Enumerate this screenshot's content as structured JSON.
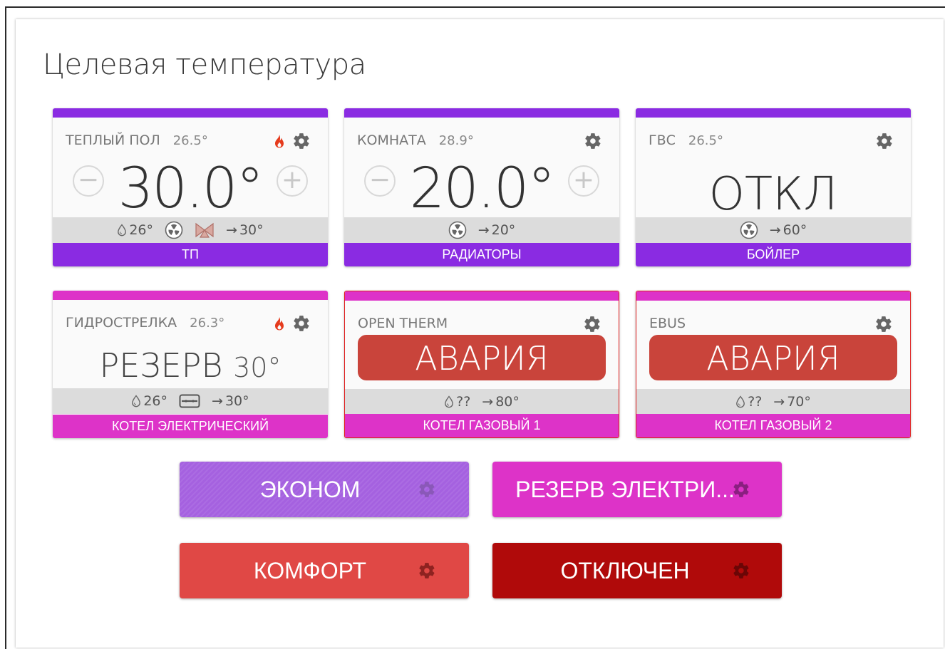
{
  "page": {
    "title": "Целевая температура"
  },
  "colors": {
    "purple": "#8a2be2",
    "magenta": "#dd33c8",
    "alarm_red": "#c9443b",
    "econom": "#a561e0",
    "comfort": "#e04845",
    "off": "#b00a0a",
    "reserve": "#dd33c8"
  },
  "cards": [
    {
      "name": "ТЕПЛЫЙ ПОЛ",
      "current": "26.5°",
      "value": "30.0°",
      "info": {
        "drop": "26°",
        "target": "30°"
      },
      "footer": "ТП",
      "icons": [
        "flame-icon",
        "gear-icon",
        "pump-icon",
        "valve-icon"
      ]
    },
    {
      "name": "КОМНАТА",
      "current": "28.9°",
      "value": "20.0°",
      "info": {
        "target": "20°"
      },
      "footer": "РАДИАТОРЫ",
      "icons": [
        "gear-icon",
        "pump-icon"
      ]
    },
    {
      "name": "ГВС",
      "current": "26.5°",
      "value": "ОТКЛ",
      "info": {
        "target": "60°"
      },
      "footer": "БОЙЛЕР",
      "icons": [
        "gear-icon",
        "pump-icon"
      ]
    },
    {
      "name": "ГИДРОСТРЕЛКА",
      "current": "26.3°",
      "value": "РЕЗЕРВ",
      "value_sub": "30°",
      "info": {
        "drop": "26°",
        "target": "30°"
      },
      "footer": "КОТЕЛ ЭЛЕКТРИЧЕСКИЙ",
      "icons": [
        "flame-icon",
        "gear-icon",
        "heater-icon"
      ]
    },
    {
      "name": "OPEN THERM",
      "value": "АВАРИЯ",
      "info": {
        "drop": "??",
        "target": "80°"
      },
      "footer": "КОТЕЛ ГАЗОВЫЙ 1",
      "icons": [
        "gear-icon"
      ]
    },
    {
      "name": "EBUS",
      "value": "АВАРИЯ",
      "info": {
        "drop": "??",
        "target": "70°"
      },
      "footer": "КОТЕЛ ГАЗОВЫЙ 2",
      "icons": [
        "gear-icon"
      ]
    }
  ],
  "modes": [
    {
      "label": "ЭКОНОМ",
      "icon": "gear-icon"
    },
    {
      "label": "РЕЗЕРВ ЭЛЕКТРИ...",
      "icon": "gear-icon"
    },
    {
      "label": "КОМФОРТ",
      "icon": "gear-icon"
    },
    {
      "label": "ОТКЛЮЧЕН",
      "icon": "gear-icon"
    }
  ],
  "glyphs": {
    "minus": "−",
    "plus": "+",
    "arrow": "→"
  }
}
